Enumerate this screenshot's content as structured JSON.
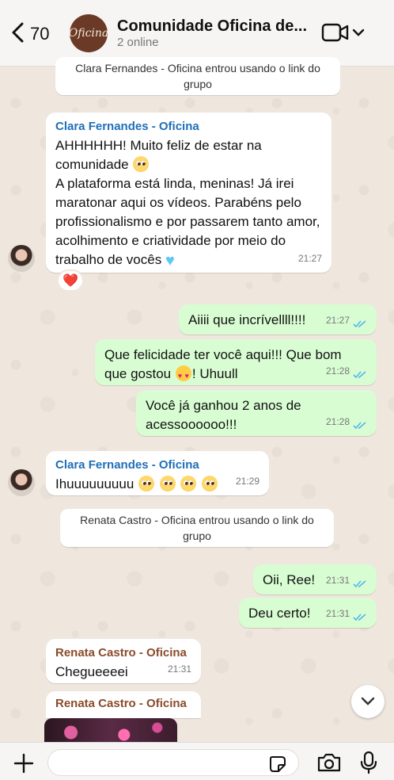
{
  "header": {
    "back_count": "70",
    "avatar_text": "Oficina",
    "title": "Comunidade Oficina de...",
    "subtitle": "2 online"
  },
  "messages": {
    "sys1": "Clara Fernandes - Oficina entrou usando o link do grupo",
    "m1": {
      "sender": "Clara Fernandes - Oficina",
      "line1": "AHHHHHH! Muito feliz de estar na comunidade",
      "line2": "A plataforma está linda, meninas! Já irei maratonar aqui os vídeos. Parabéns pelo profissionalismo e por passarem tanto amor, acolhimento e criatividade por meio do trabalho de vocês",
      "time": "21:27",
      "reaction": "❤️"
    },
    "m2": {
      "text": "Aiiii que incrívellll!!!!",
      "time": "21:27"
    },
    "m3": {
      "text": "Que felicidade ter você aqui!!! Que bom que gostou",
      "text_after": "! Uhuull",
      "time": "21:28"
    },
    "m4": {
      "text": "Você já ganhou 2 anos de acessoooooo!!!",
      "time": "21:28"
    },
    "m5": {
      "sender": "Clara Fernandes - Oficina",
      "text": "Ihuuuuuuuuu",
      "time": "21:29"
    },
    "sys2": "Renata Castro - Oficina entrou usando o link do grupo",
    "m6": {
      "text": "Oii, Ree!",
      "time": "21:31"
    },
    "m7": {
      "text": "Deu certo!",
      "time": "21:31"
    },
    "m8": {
      "sender": "Renata Castro - Oficina",
      "text": "Chegueeeei",
      "time": "21:31"
    },
    "m9": {
      "sender": "Renata Castro - Oficina"
    }
  },
  "composer": {
    "value": "",
    "placeholder": ""
  },
  "colors": {
    "clara_sender": "#1f6fb8",
    "renata_sender": "#8a4b2a",
    "outgoing_bubble": "#d9fdd3",
    "read_ticks": "#4fb6ec"
  },
  "icons": [
    "back-chevron-icon",
    "video-call-icon",
    "chevron-down-icon",
    "plus-icon",
    "sticker-icon",
    "camera-icon",
    "mic-icon",
    "read-ticks-icon",
    "scroll-down-icon"
  ]
}
